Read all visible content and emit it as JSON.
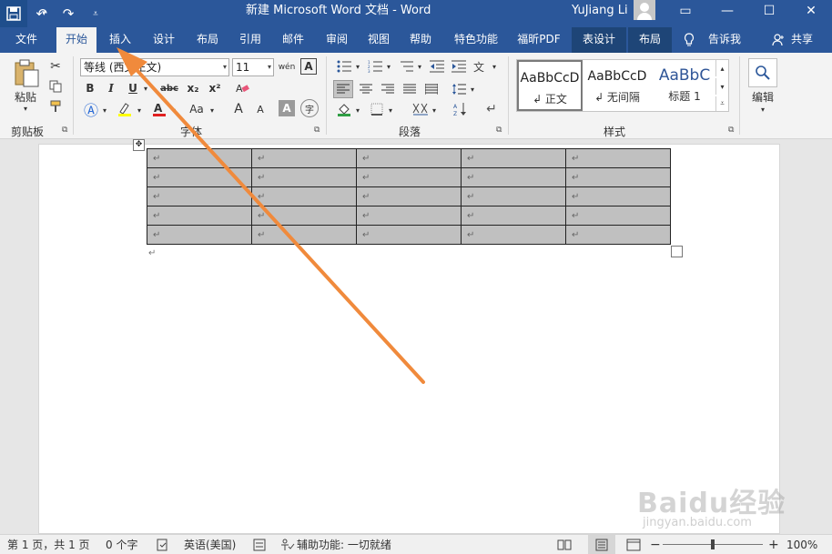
{
  "titlebar": {
    "title": "新建 Microsoft Word 文档 - Word",
    "user": "YuJiang Li",
    "qat": {
      "save_icon": "save-icon",
      "undo_icon": "undo-icon",
      "redo_icon": "redo-icon"
    },
    "window": {
      "ribbon_display": "▭",
      "minimize": "—",
      "maximize": "☐",
      "close": "✕"
    }
  },
  "tabs": [
    {
      "label": "文件"
    },
    {
      "label": "开始"
    },
    {
      "label": "插入"
    },
    {
      "label": "设计"
    },
    {
      "label": "布局"
    },
    {
      "label": "引用"
    },
    {
      "label": "邮件"
    },
    {
      "label": "审阅"
    },
    {
      "label": "视图"
    },
    {
      "label": "帮助"
    },
    {
      "label": "特色功能"
    },
    {
      "label": "福昕PDF"
    },
    {
      "label": "表设计"
    },
    {
      "label": "布局"
    }
  ],
  "tell_me": "告诉我",
  "share": "共享",
  "ribbon": {
    "clipboard": {
      "paste": "粘贴",
      "label": "剪贴板"
    },
    "font": {
      "name": "等线 (西文正文)",
      "size": "11",
      "label": "字体",
      "bold": "B",
      "italic": "I",
      "underline": "U",
      "strike": "abc",
      "sub": "x₂",
      "sup": "x²",
      "case": "Aa",
      "grow": "A",
      "shrink": "A",
      "pinyin": "wén",
      "border_char": "A",
      "shade_char": "A",
      "circle_char": "字"
    },
    "paragraph": {
      "label": "段落"
    },
    "styles": {
      "label": "样式",
      "items": [
        {
          "preview": "AaBbCcD",
          "name": "↲ 正文"
        },
        {
          "preview": "AaBbCcD",
          "name": "↲ 无间隔"
        },
        {
          "preview": "AaBbC",
          "name": "标题 1"
        }
      ]
    },
    "editing": {
      "label": "编辑"
    }
  },
  "table": {
    "rows": 5,
    "cols": 5,
    "cell_mark": "↵"
  },
  "status": {
    "page": "第 1 页，共 1 页",
    "words": "0 个字",
    "language": "英语(美国)",
    "accessibility": "辅助功能: 一切就绪",
    "zoom": "100%",
    "zoom_minus": "−",
    "zoom_plus": "+"
  },
  "watermark": {
    "text": "Baidu经验",
    "sub": "jingyan.baidu.com"
  },
  "colors": {
    "brand": "#2b579a",
    "arrow": "#f08a3c"
  }
}
